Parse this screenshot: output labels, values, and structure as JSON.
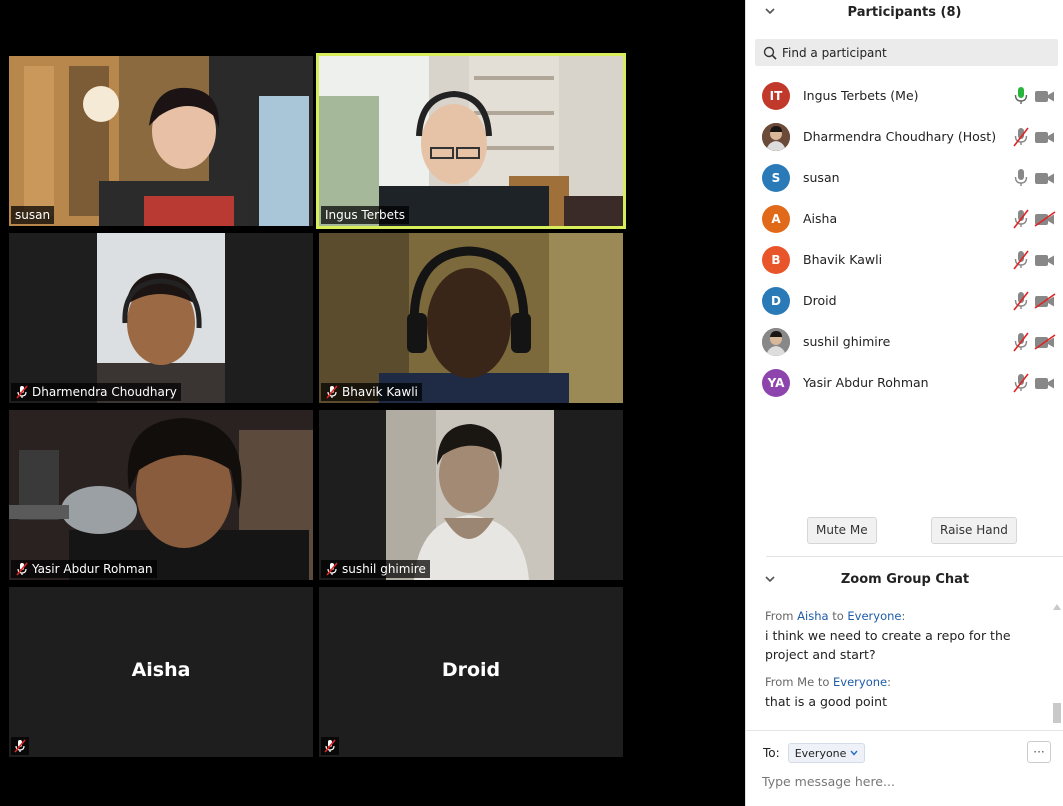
{
  "video_tiles": [
    {
      "name": "susan",
      "muted": false
    },
    {
      "name": "Ingus Terbets",
      "muted": false,
      "active_speaker": true
    },
    {
      "name": "Dharmendra Choudhary",
      "muted": true
    },
    {
      "name": "Bhavik Kawli",
      "muted": true
    },
    {
      "name": "Yasir Abdur Rohman",
      "muted": true
    },
    {
      "name": "sushil ghimire",
      "muted": true
    },
    {
      "name": "Aisha",
      "muted": true,
      "video_off": true
    },
    {
      "name": "Droid",
      "muted": true,
      "video_off": true
    }
  ],
  "participants_panel": {
    "title": "Participants (8)",
    "search_placeholder": "Find a participant",
    "participants": [
      {
        "initials": "IT",
        "name": "Ingus Terbets (Me)",
        "avatar_color": "#c0392b",
        "mic": "speaking",
        "video": "on"
      },
      {
        "initials": "",
        "name": "Dharmendra Choudhary (Host)",
        "avatar_color": "#6b4a3a",
        "mic": "muted",
        "video": "on"
      },
      {
        "initials": "S",
        "name": "susan",
        "avatar_color": "#2a7ab8",
        "mic": "on",
        "video": "on"
      },
      {
        "initials": "A",
        "name": "Aisha",
        "avatar_color": "#e06a1a",
        "mic": "muted",
        "video": "off"
      },
      {
        "initials": "B",
        "name": "Bhavik Kawli",
        "avatar_color": "#e8552a",
        "mic": "muted",
        "video": "on"
      },
      {
        "initials": "D",
        "name": "Droid",
        "avatar_color": "#2a7ab8",
        "mic": "muted",
        "video": "off"
      },
      {
        "initials": "",
        "name": "sushil ghimire",
        "avatar_color": "#888888",
        "mic": "muted",
        "video": "off"
      },
      {
        "initials": "YA",
        "name": "Yasir Abdur Rohman",
        "avatar_color": "#8e44ad",
        "mic": "muted",
        "video": "on"
      }
    ],
    "mute_me_label": "Mute Me",
    "raise_hand_label": "Raise Hand"
  },
  "chat": {
    "title": "Zoom Group Chat",
    "messages": [
      {
        "from_prefix": "From",
        "sender": "Aisha",
        "to_word": "to",
        "recipient": "Everyone",
        "text": "i think we need to create a repo for the project and start?"
      },
      {
        "from_prefix": "From Me",
        "sender": "",
        "to_word": "to",
        "recipient": "Everyone",
        "text": "that is a good point"
      }
    ],
    "to_label": "To:",
    "to_value": "Everyone",
    "more_label": "···",
    "input_placeholder": "Type message here..."
  },
  "colors": {
    "active_speaker_border": "#d7ee5a",
    "muted_red": "#e02424",
    "speaking_green": "#27b53c",
    "link_blue": "#1e5ba8"
  }
}
